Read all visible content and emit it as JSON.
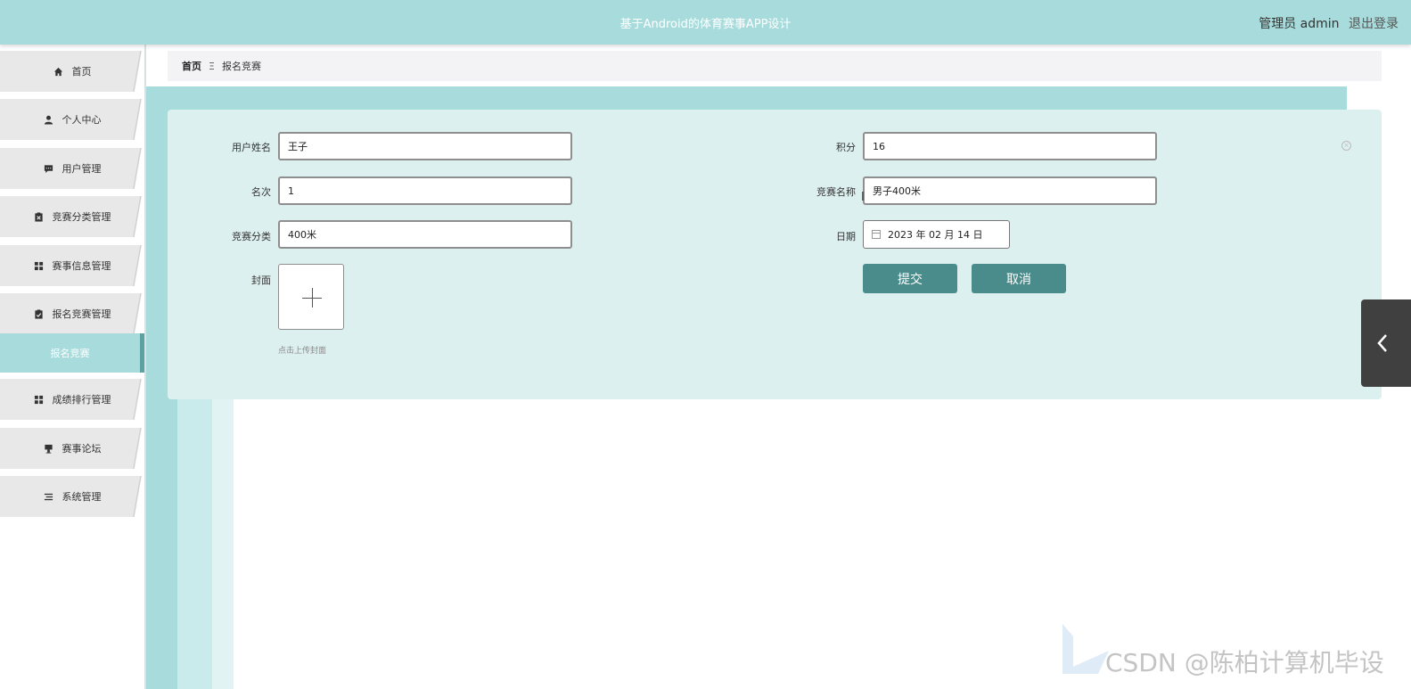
{
  "header": {
    "app_title": "基于Android的体育赛事APP设计",
    "user_label": "管理员 admin",
    "logout_label": "退出登录",
    "accent_color": "#a8dcdc"
  },
  "sidebar": {
    "items": [
      {
        "label": "首页",
        "icon": "home-icon"
      },
      {
        "label": "个人中心",
        "icon": "user-icon"
      },
      {
        "label": "用户管理",
        "icon": "chat-icon"
      },
      {
        "label": "竞赛分类管理",
        "icon": "clipboard-x-icon"
      },
      {
        "label": "赛事信息管理",
        "icon": "grid-icon"
      },
      {
        "label": "报名竞赛管理",
        "icon": "clipboard-check-icon"
      },
      {
        "label": "报名竞赛",
        "icon": "",
        "active": true
      },
      {
        "label": "成绩排行管理",
        "icon": "grid-icon"
      },
      {
        "label": "赛事论坛",
        "icon": "podium-icon"
      },
      {
        "label": "系统管理",
        "icon": "list-icon"
      }
    ]
  },
  "breadcrumb": {
    "home": "首页",
    "separator": "Ξ",
    "current": "报名竞赛"
  },
  "form": {
    "username": {
      "label": "用户姓名",
      "value": "王子"
    },
    "score": {
      "label": "积分",
      "value": "16"
    },
    "rank": {
      "label": "名次",
      "value": "1"
    },
    "competition_name": {
      "label": "竞赛名称",
      "value": "男子400米"
    },
    "category": {
      "label": "竞赛分类",
      "value": "400米"
    },
    "date": {
      "label": "日期",
      "value": "2023 年 02 月 14 日"
    },
    "cover": {
      "label": "封面",
      "hint": "点击上传封面"
    },
    "submit_label": "提交",
    "cancel_label": "取消",
    "button_color": "#4a8c8c"
  },
  "watermark": {
    "text": "CSDN @陈柏计算机毕设"
  }
}
